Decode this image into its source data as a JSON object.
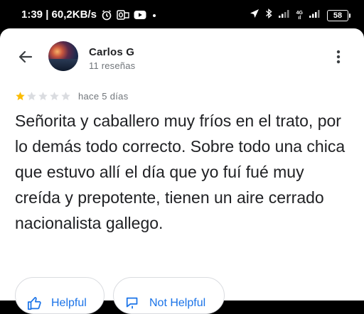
{
  "status_bar": {
    "time_info": "1:39 | 60,2KB/s",
    "network_badge_top": "4G",
    "network_badge_bottom": "ıl",
    "battery": "58"
  },
  "header": {
    "user_name": "Carlos G",
    "review_count": "11 reseñas"
  },
  "review": {
    "rating": 1,
    "max_rating": 5,
    "date": "hace 5 días",
    "text": "Señorita y caballero muy fríos en el trato, por lo demás todo correcto. Sobre todo una chica que estuvo allí el día que yo fuí fué muy creída y prepotente, tienen un aire cerrado nacionalista gallego."
  },
  "actions": {
    "helpful_label": "Helpful",
    "not_helpful_label": "Not Helpful"
  },
  "colors": {
    "star_filled": "#fbbc04",
    "star_empty": "#dadce0",
    "accent": "#1a73e8"
  }
}
